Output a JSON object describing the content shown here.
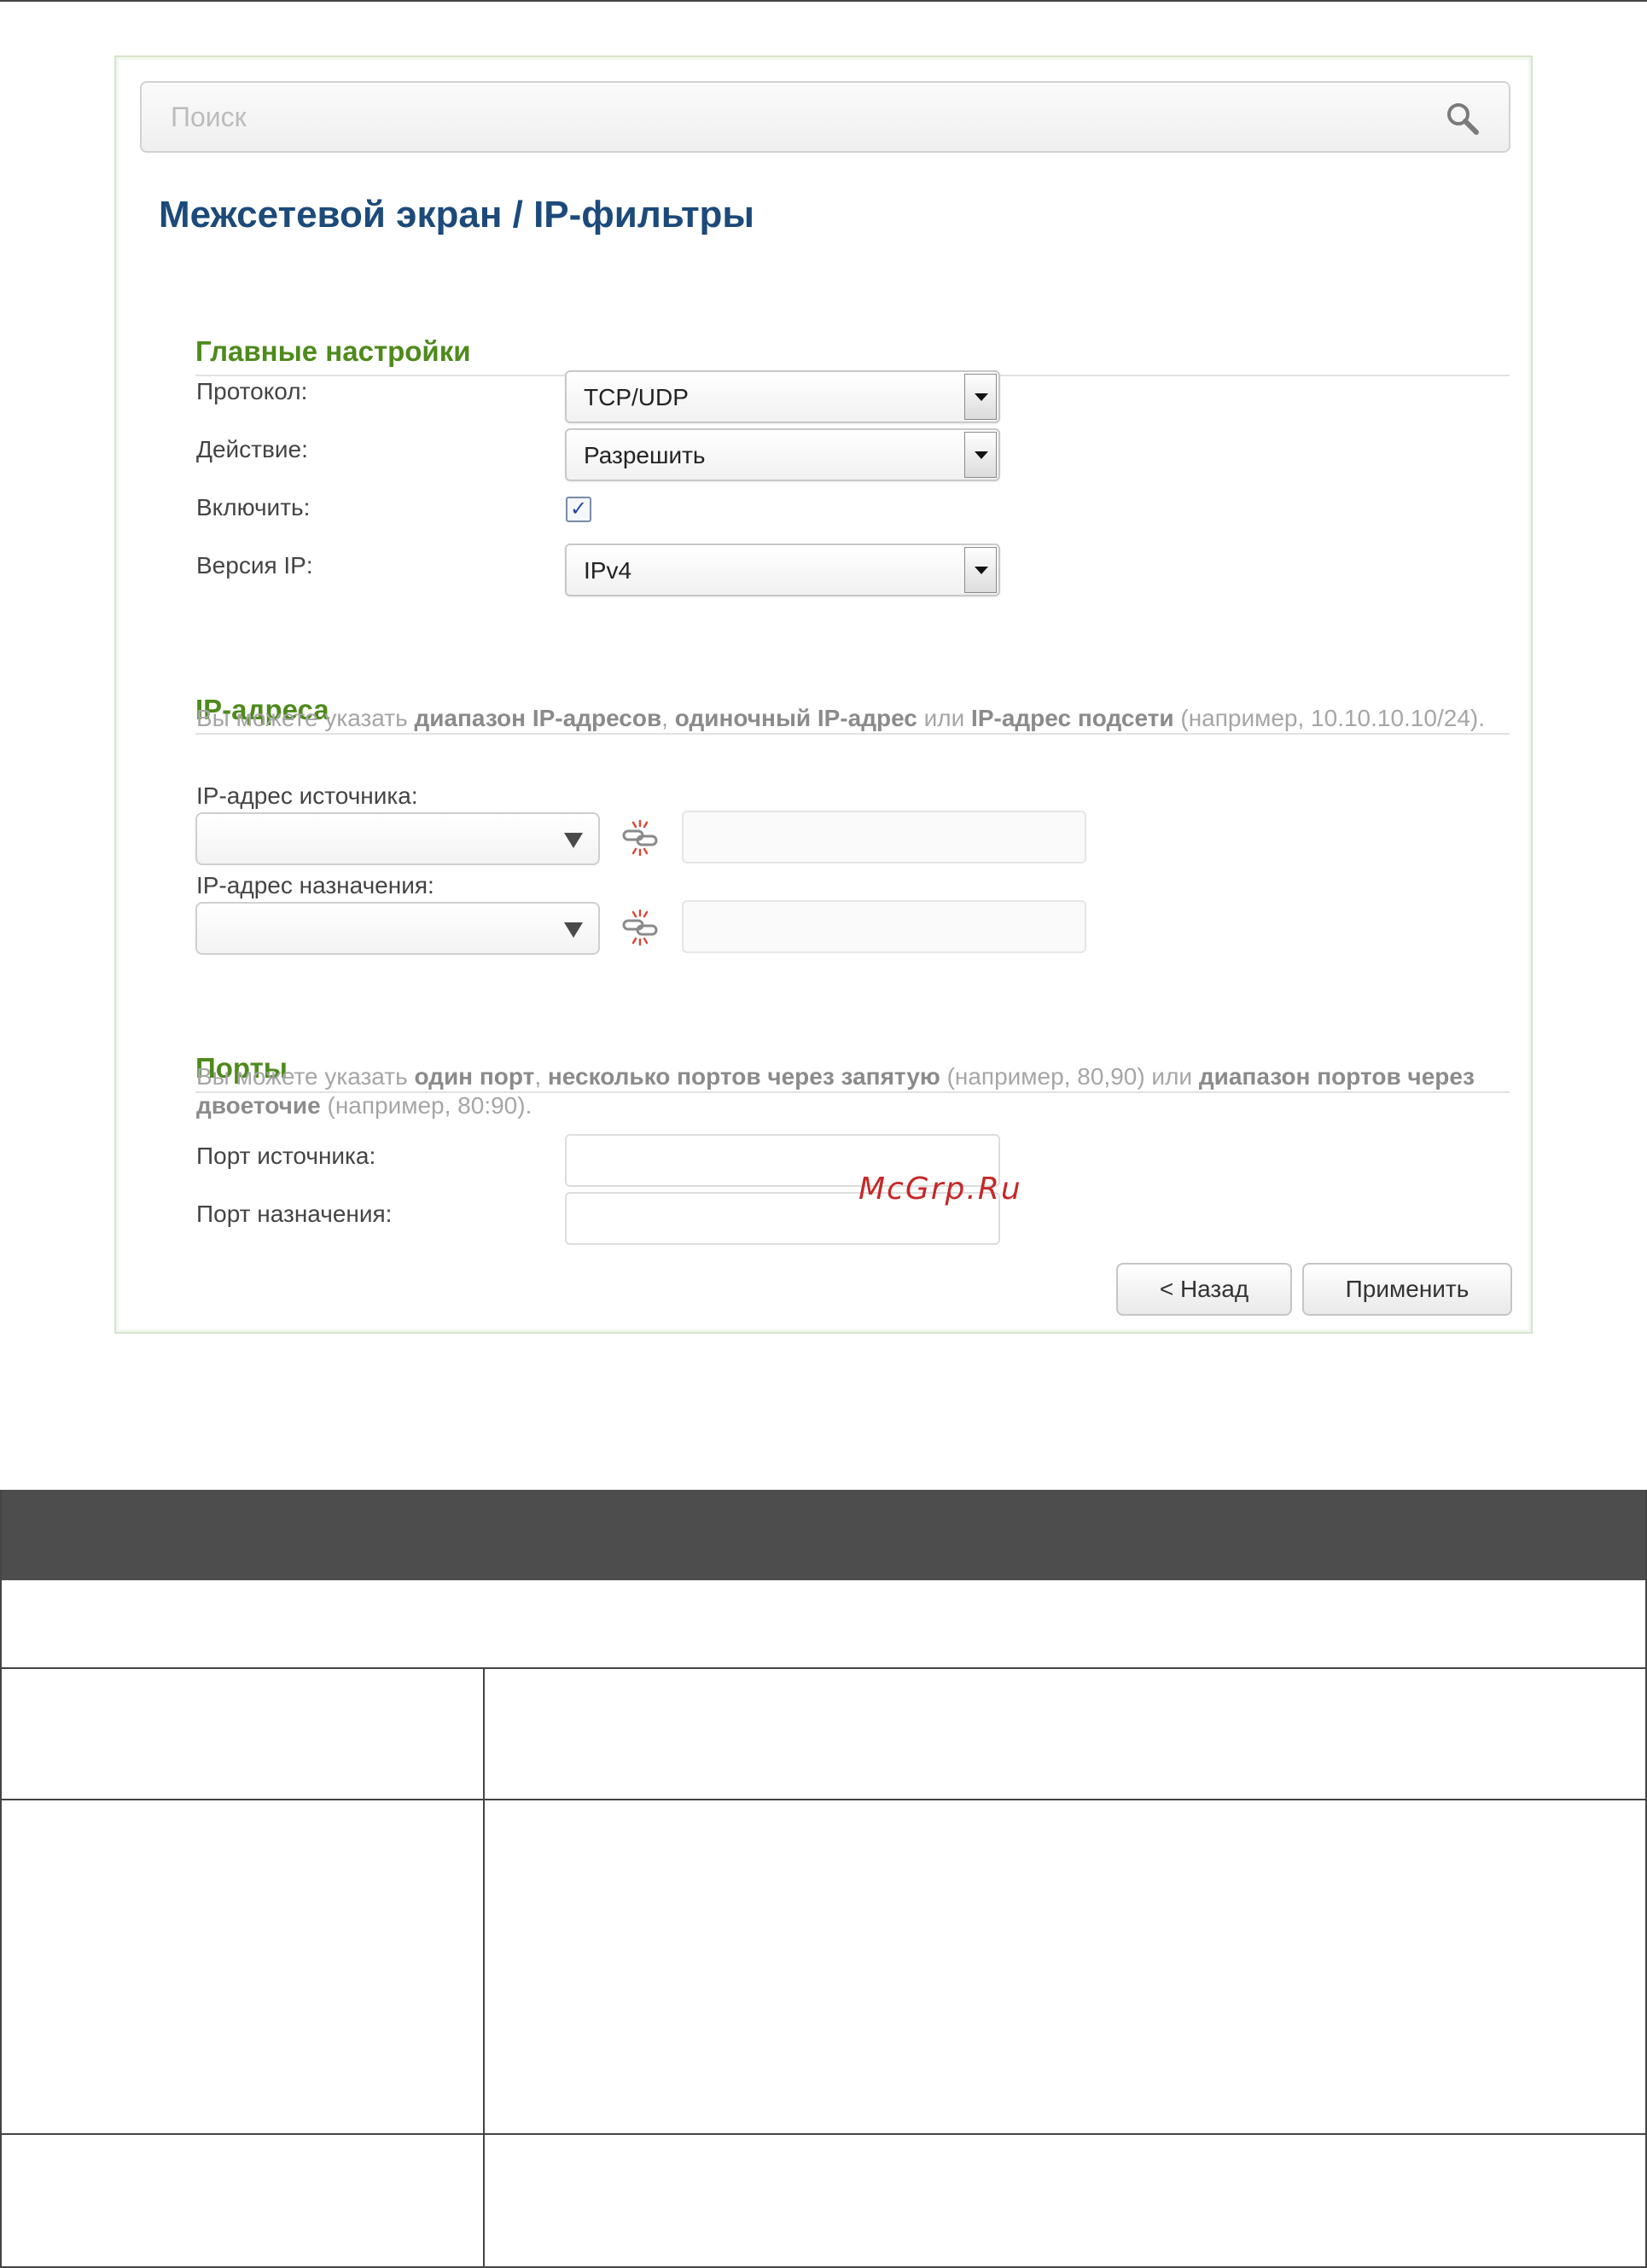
{
  "search": {
    "placeholder": "Поиск"
  },
  "page": {
    "title": "Межсетевой экран /  IP-фильтры"
  },
  "main_settings": {
    "title": "Главные настройки",
    "protocol": {
      "label": "Протокол:",
      "value": "TCP/UDP"
    },
    "action": {
      "label": "Действие:",
      "value": "Разрешить"
    },
    "enable": {
      "label": "Включить:",
      "checked": true,
      "mark": "✓"
    },
    "ip_version": {
      "label": "Версия IP:",
      "value": "IPv4"
    }
  },
  "ip_addresses": {
    "title": "IP-адреса",
    "hint": {
      "t1": "Вы можете указать ",
      "b1": "диапазон IP-адресов",
      "t2": ", ",
      "b2": "одиночный IP-адрес",
      "t3": " или ",
      "b3": "IP-адрес подсети",
      "t4": " (например, 10.10.10.10/24)."
    },
    "source_label": "IP-адрес источника:",
    "destination_label": "IP-адрес назначения:"
  },
  "ports": {
    "title": "Порты",
    "hint": {
      "t1": "Вы можете указать ",
      "b1": "один порт",
      "t2": ", ",
      "b2": "несколько портов через запятую",
      "t3": " (например, 80,90) или ",
      "b3": "диапазон портов через двоеточие",
      "t4": " (например, 80:90)."
    },
    "source_label": "Порт источника:",
    "destination_label": "Порт назначения:"
  },
  "buttons": {
    "back": "< Назад",
    "apply": "Применить"
  },
  "watermark": "McGrp.Ru",
  "icons": {
    "search": "magnifier-icon",
    "link": "link-broken-icon"
  },
  "colors": {
    "title": "#1c4a7a",
    "section": "#4e8a1c",
    "table_header": "#4d4d4d",
    "watermark": "#c62828"
  }
}
